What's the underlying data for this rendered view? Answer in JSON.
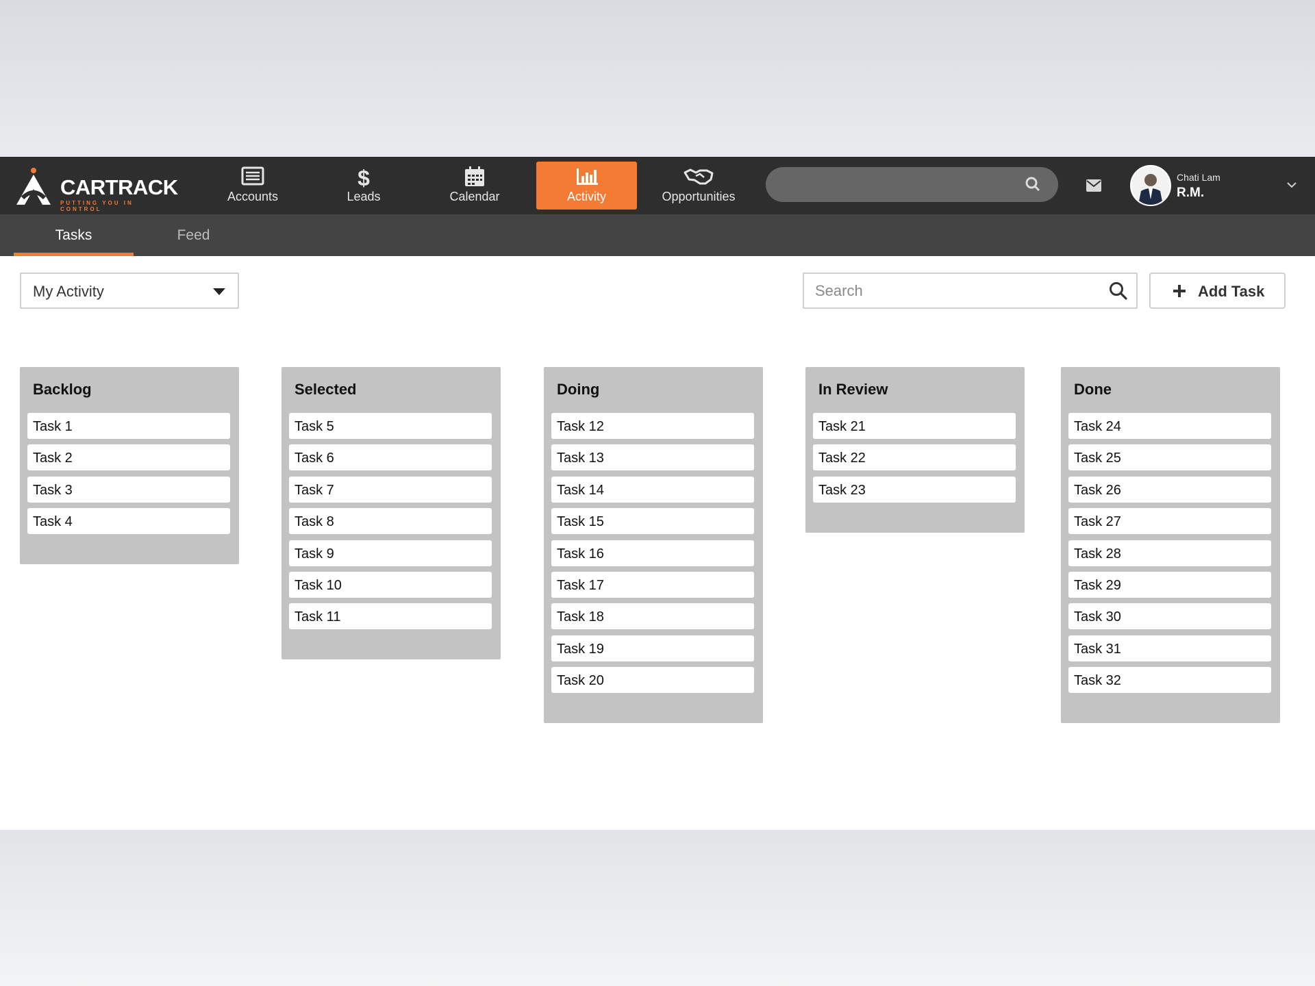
{
  "brand": {
    "name": "CARTRACK",
    "tagline": "PUTTING YOU IN CONTROL",
    "accent_color": "#f47b33"
  },
  "nav": {
    "items": [
      {
        "label": "Accounts",
        "icon": "accounts-icon",
        "active": false
      },
      {
        "label": "Leads",
        "icon": "dollar-icon",
        "active": false
      },
      {
        "label": "Calendar",
        "icon": "calendar-icon",
        "active": false
      },
      {
        "label": "Activity",
        "icon": "bar-chart-icon",
        "active": true
      },
      {
        "label": "Opportunities",
        "icon": "handshake-icon",
        "active": false
      }
    ]
  },
  "header_search": {
    "placeholder": ""
  },
  "user": {
    "name": "Chati Lam",
    "role": "R.M."
  },
  "subtabs": [
    {
      "label": "Tasks",
      "active": true
    },
    {
      "label": "Feed",
      "active": false
    }
  ],
  "toolbar": {
    "filter_value": "My Activity",
    "search_placeholder": "Search",
    "add_label": "Add Task"
  },
  "columns": [
    {
      "title": "Backlog",
      "tasks": [
        "Task 1",
        "Task 2",
        "Task 3",
        "Task 4"
      ]
    },
    {
      "title": "Selected",
      "tasks": [
        "Task 5",
        "Task 6",
        "Task 7",
        "Task 8",
        "Task 9",
        "Task 10",
        "Task 11"
      ]
    },
    {
      "title": "Doing",
      "tasks": [
        "Task 12",
        "Task 13",
        "Task 14",
        "Task 15",
        "Task 16",
        "Task 17",
        "Task 18",
        "Task 19",
        "Task 20"
      ]
    },
    {
      "title": "In Review",
      "tasks": [
        "Task 21",
        "Task 22",
        "Task 23"
      ]
    },
    {
      "title": "Done",
      "tasks": [
        "Task 24",
        "Task 25",
        "Task 26",
        "Task 27",
        "Task 28",
        "Task 29",
        "Task 30",
        "Task 31",
        "Task 32"
      ]
    }
  ]
}
